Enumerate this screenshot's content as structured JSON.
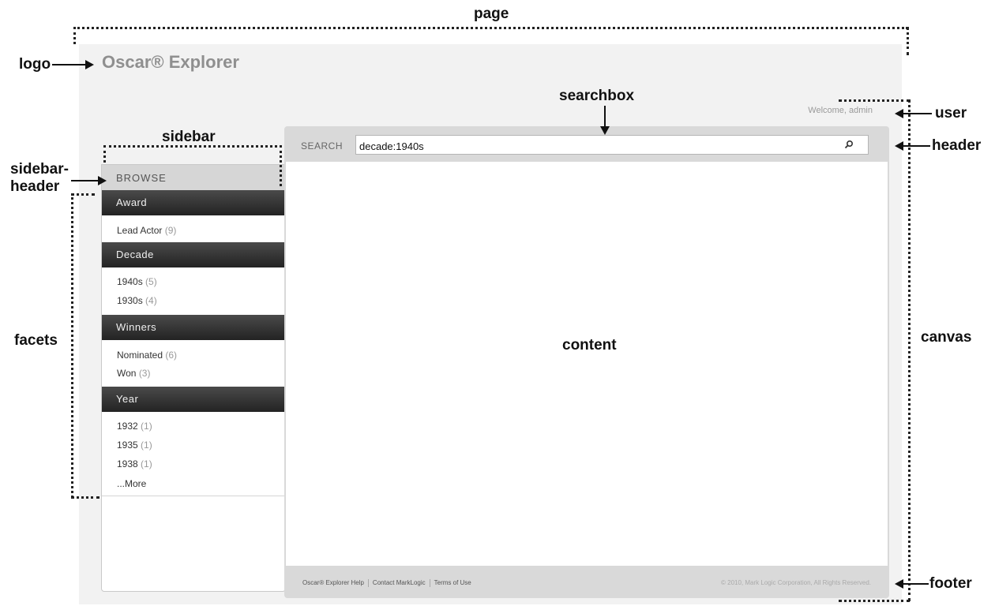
{
  "annotations": {
    "page": "page",
    "logo": "logo",
    "searchbox": "searchbox",
    "sidebar": "sidebar",
    "user": "user",
    "sidebar_header_1": "sidebar-",
    "sidebar_header_2": "header",
    "header": "header",
    "facets": "facets",
    "content": "content",
    "canvas": "canvas",
    "footer": "footer"
  },
  "app": {
    "logo": "Oscar® Explorer",
    "welcome": "Welcome, admin"
  },
  "search": {
    "label": "SEARCH",
    "value": "decade:1940s",
    "icon": "search-icon"
  },
  "sidebar": {
    "header": "BROWSE",
    "facets": [
      {
        "title": "Award",
        "items": [
          {
            "label": "Lead Actor",
            "count": "(9)"
          }
        ]
      },
      {
        "title": "Decade",
        "items": [
          {
            "label": "1940s",
            "count": "(5)"
          },
          {
            "label": "1930s",
            "count": "(4)"
          }
        ]
      },
      {
        "title": "Winners",
        "items": [
          {
            "label": "Nominated",
            "count": "(6)"
          },
          {
            "label": "Won",
            "count": "(3)"
          }
        ]
      },
      {
        "title": "Year",
        "items": [
          {
            "label": "1932",
            "count": "(1)"
          },
          {
            "label": "1935",
            "count": "(1)"
          },
          {
            "label": "1938",
            "count": "(1)"
          }
        ],
        "more": "...More"
      }
    ]
  },
  "footer": {
    "links": [
      "Oscar® Explorer Help",
      "Contact MarkLogic",
      "Terms of Use"
    ],
    "copyright": "© 2010, Mark Logic Corporation, All Rights Reserved."
  }
}
